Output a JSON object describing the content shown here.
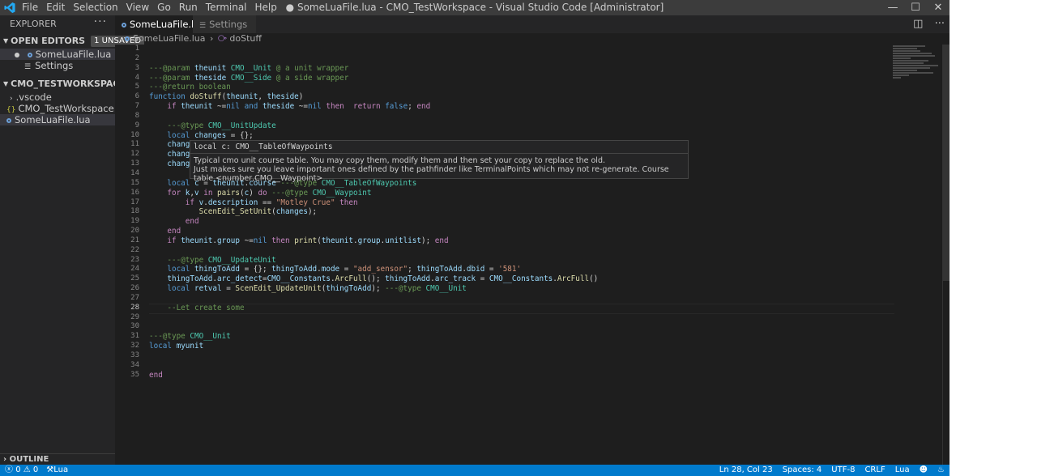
{
  "titlebar": {
    "menu": [
      "File",
      "Edit",
      "Selection",
      "View",
      "Go",
      "Run",
      "Terminal",
      "Help"
    ],
    "title": "● SomeLuaFile.lua - CMO_TestWorkspace - Visual Studio Code [Administrator]"
  },
  "sidebar": {
    "header": "EXPLORER",
    "open_editors_label": "OPEN EDITORS",
    "unsaved_badge": "1 UNSAVED",
    "open_editors": [
      "SomeLuaFile.lua",
      "Settings"
    ],
    "workspace_label": "CMO_TESTWORKSPACE",
    "tree": [
      ".vscode",
      "CMO_TestWorkspace.code-wor...",
      "SomeLuaFile.lua"
    ],
    "outline_label": "OUTLINE"
  },
  "tabs": [
    {
      "label": "SomeLuaFile.lua"
    },
    {
      "label": "Settings"
    }
  ],
  "breadcrumb": {
    "file": "SomeLuaFile.lua",
    "symbol": "doStuff"
  },
  "editor": {
    "line_numbers": [
      "1",
      "2",
      "3",
      "4",
      "5",
      "6",
      "7",
      "8",
      "9",
      "10",
      "11",
      "12",
      "13",
      "14",
      "15",
      "16",
      "17",
      "18",
      "19",
      "20",
      "21",
      "22",
      "23",
      "24",
      "25",
      "26",
      "27",
      "28",
      "29",
      "30",
      "31",
      "32",
      "33",
      "34",
      "35"
    ],
    "current_line": "28"
  },
  "hover": {
    "signature": "local c: CMO__TableOfWaypoints",
    "doc_line1": "Typical cmo unit course table. You may copy them, modify them and then set your copy to replace the old.",
    "doc_line2": "Just makes sure you leave important ones defined by the pathfinder like TerminalPoints which may not re-generate. Course table <number,CMO__Waypoint>"
  },
  "statusbar": {
    "errors": "0",
    "warnings": "0",
    "lang_item": "Lua",
    "position": "Ln 28, Col 23",
    "spaces": "Spaces: 4",
    "encoding": "UTF-8",
    "eol": "CRLF",
    "language": "Lua"
  },
  "colors": {
    "accent": "#007acc",
    "editor_bg": "#1e1e1e",
    "sidebar_bg": "#252526"
  }
}
